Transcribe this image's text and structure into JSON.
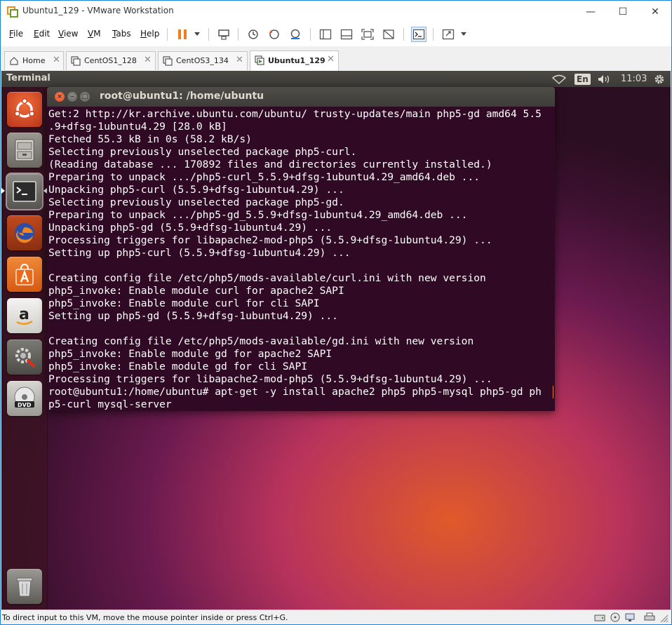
{
  "window": {
    "title": "Ubuntu1_129 - VMware Workstation",
    "controls": {
      "minimize": "—",
      "maximize": "☐",
      "close": "✕"
    }
  },
  "menu": {
    "file": {
      "first": "F",
      "rest": "ile"
    },
    "edit": {
      "first": "E",
      "rest": "dit"
    },
    "view": {
      "first": "V",
      "rest": "iew"
    },
    "vm": {
      "first": "V",
      "rest": "M"
    },
    "tabs": {
      "first": "T",
      "rest": "abs"
    },
    "help": {
      "first": "H",
      "rest": "elp"
    }
  },
  "tabs": [
    {
      "label": "Home",
      "close": "✕",
      "active": false
    },
    {
      "label": "CentOS1_128",
      "close": "✕",
      "active": false
    },
    {
      "label": "CentOS3_134",
      "close": "✕",
      "active": false
    },
    {
      "label": "Ubuntu1_129",
      "close": "✕",
      "active": true
    }
  ],
  "ubuntu_panel": {
    "app_title": "Terminal",
    "language": "En",
    "clock": "11:03"
  },
  "launcher": [
    {
      "name": "ubuntu-dash"
    },
    {
      "name": "files"
    },
    {
      "name": "terminal",
      "active": true
    },
    {
      "name": "firefox"
    },
    {
      "name": "software-center"
    },
    {
      "name": "amazon"
    },
    {
      "name": "system-settings"
    },
    {
      "name": "dvd"
    },
    {
      "name": "trash"
    }
  ],
  "terminal": {
    "title": "root@ubuntu1: /home/ubuntu",
    "lines": [
      "Get:2 http://kr.archive.ubuntu.com/ubuntu/ trusty-updates/main php5-gd amd64 5.5",
      ".9+dfsg-1ubuntu4.29 [28.0 kB]",
      "Fetched 55.3 kB in 0s (58.2 kB/s)",
      "Selecting previously unselected package php5-curl.",
      "(Reading database ... 170892 files and directories currently installed.)",
      "Preparing to unpack .../php5-curl_5.5.9+dfsg-1ubuntu4.29_amd64.deb ...",
      "Unpacking php5-curl (5.5.9+dfsg-1ubuntu4.29) ...",
      "Selecting previously unselected package php5-gd.",
      "Preparing to unpack .../php5-gd_5.5.9+dfsg-1ubuntu4.29_amd64.deb ...",
      "Unpacking php5-gd (5.5.9+dfsg-1ubuntu4.29) ...",
      "Processing triggers for libapache2-mod-php5 (5.5.9+dfsg-1ubuntu4.29) ...",
      "Setting up php5-curl (5.5.9+dfsg-1ubuntu4.29) ...",
      "",
      "Creating config file /etc/php5/mods-available/curl.ini with new version",
      "php5_invoke: Enable module curl for apache2 SAPI",
      "php5_invoke: Enable module curl for cli SAPI",
      "Setting up php5-gd (5.5.9+dfsg-1ubuntu4.29) ...",
      "",
      "Creating config file /etc/php5/mods-available/gd.ini with new version",
      "php5_invoke: Enable module gd for apache2 SAPI",
      "php5_invoke: Enable module gd for cli SAPI",
      "Processing triggers for libapache2-mod-php5 (5.5.9+dfsg-1ubuntu4.29) ...",
      "root@ubuntu1:/home/ubuntu# apt-get -y install apache2 php5 php5-mysql php5-gd ph",
      "p5-curl mysql-server"
    ]
  },
  "statusbar": {
    "text": "To direct input to this VM, move the mouse pointer inside or press Ctrl+G."
  },
  "colors": {
    "terminal_bg": "#300a24",
    "panel_bg": "#3c3b37",
    "window_border": "#1883d7",
    "accent_orange": "#f07746"
  }
}
